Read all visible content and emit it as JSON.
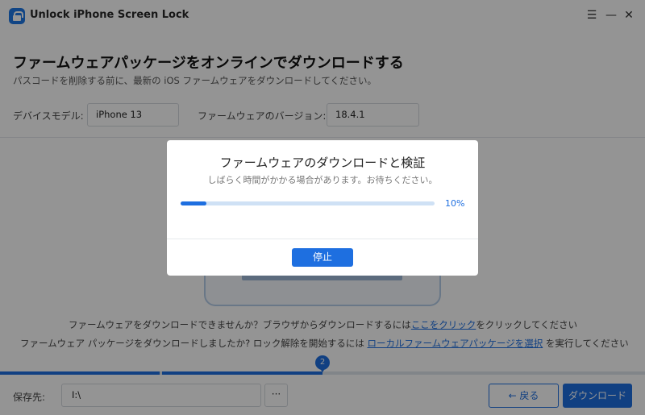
{
  "window": {
    "title": "Unlock iPhone Screen Lock",
    "menu_glyph": "☰",
    "minimize_glyph": "—",
    "close_glyph": "✕"
  },
  "header": {
    "title": "ファームウェアパッケージをオンラインでダウンロードする",
    "subtitle": "パスコードを削除する前に、最新の iOS ファームウェアをダウンロードしてください。"
  },
  "device": {
    "model_label": "デバイスモデル:",
    "model_value": "iPhone 13",
    "version_label": "ファームウェアのバージョン:",
    "version_value": "18.4.1"
  },
  "help": {
    "line1_prefix": "ファームウェアをダウンロードできませんか？ブラウザからダウンロードするには",
    "line1_link": "ここをクリック",
    "line1_suffix": "をクリックしてください",
    "line2_prefix": "ファームウェア パッケージをダウンロードしましたか? ロック解除を開始するには ",
    "line2_link": "ローカルファームウェアパッケージを選択",
    "line2_suffix": " を実行してください"
  },
  "steps": {
    "current": "2"
  },
  "footer": {
    "save_label": "保存先:",
    "save_path": "I:\\",
    "browse_label": "···",
    "back_label": "← 戻る",
    "download_label": "ダウンロード"
  },
  "modal": {
    "title": "ファームウェアのダウンロードと検証",
    "subtitle": "しばらく時間がかかる場合があります。お待ちください。",
    "progress_percent": 10,
    "progress_text": "10%",
    "stop_label": "停止"
  },
  "colors": {
    "accent": "#1e6fe0",
    "overlay": "rgba(0,0,0,0.42)"
  }
}
